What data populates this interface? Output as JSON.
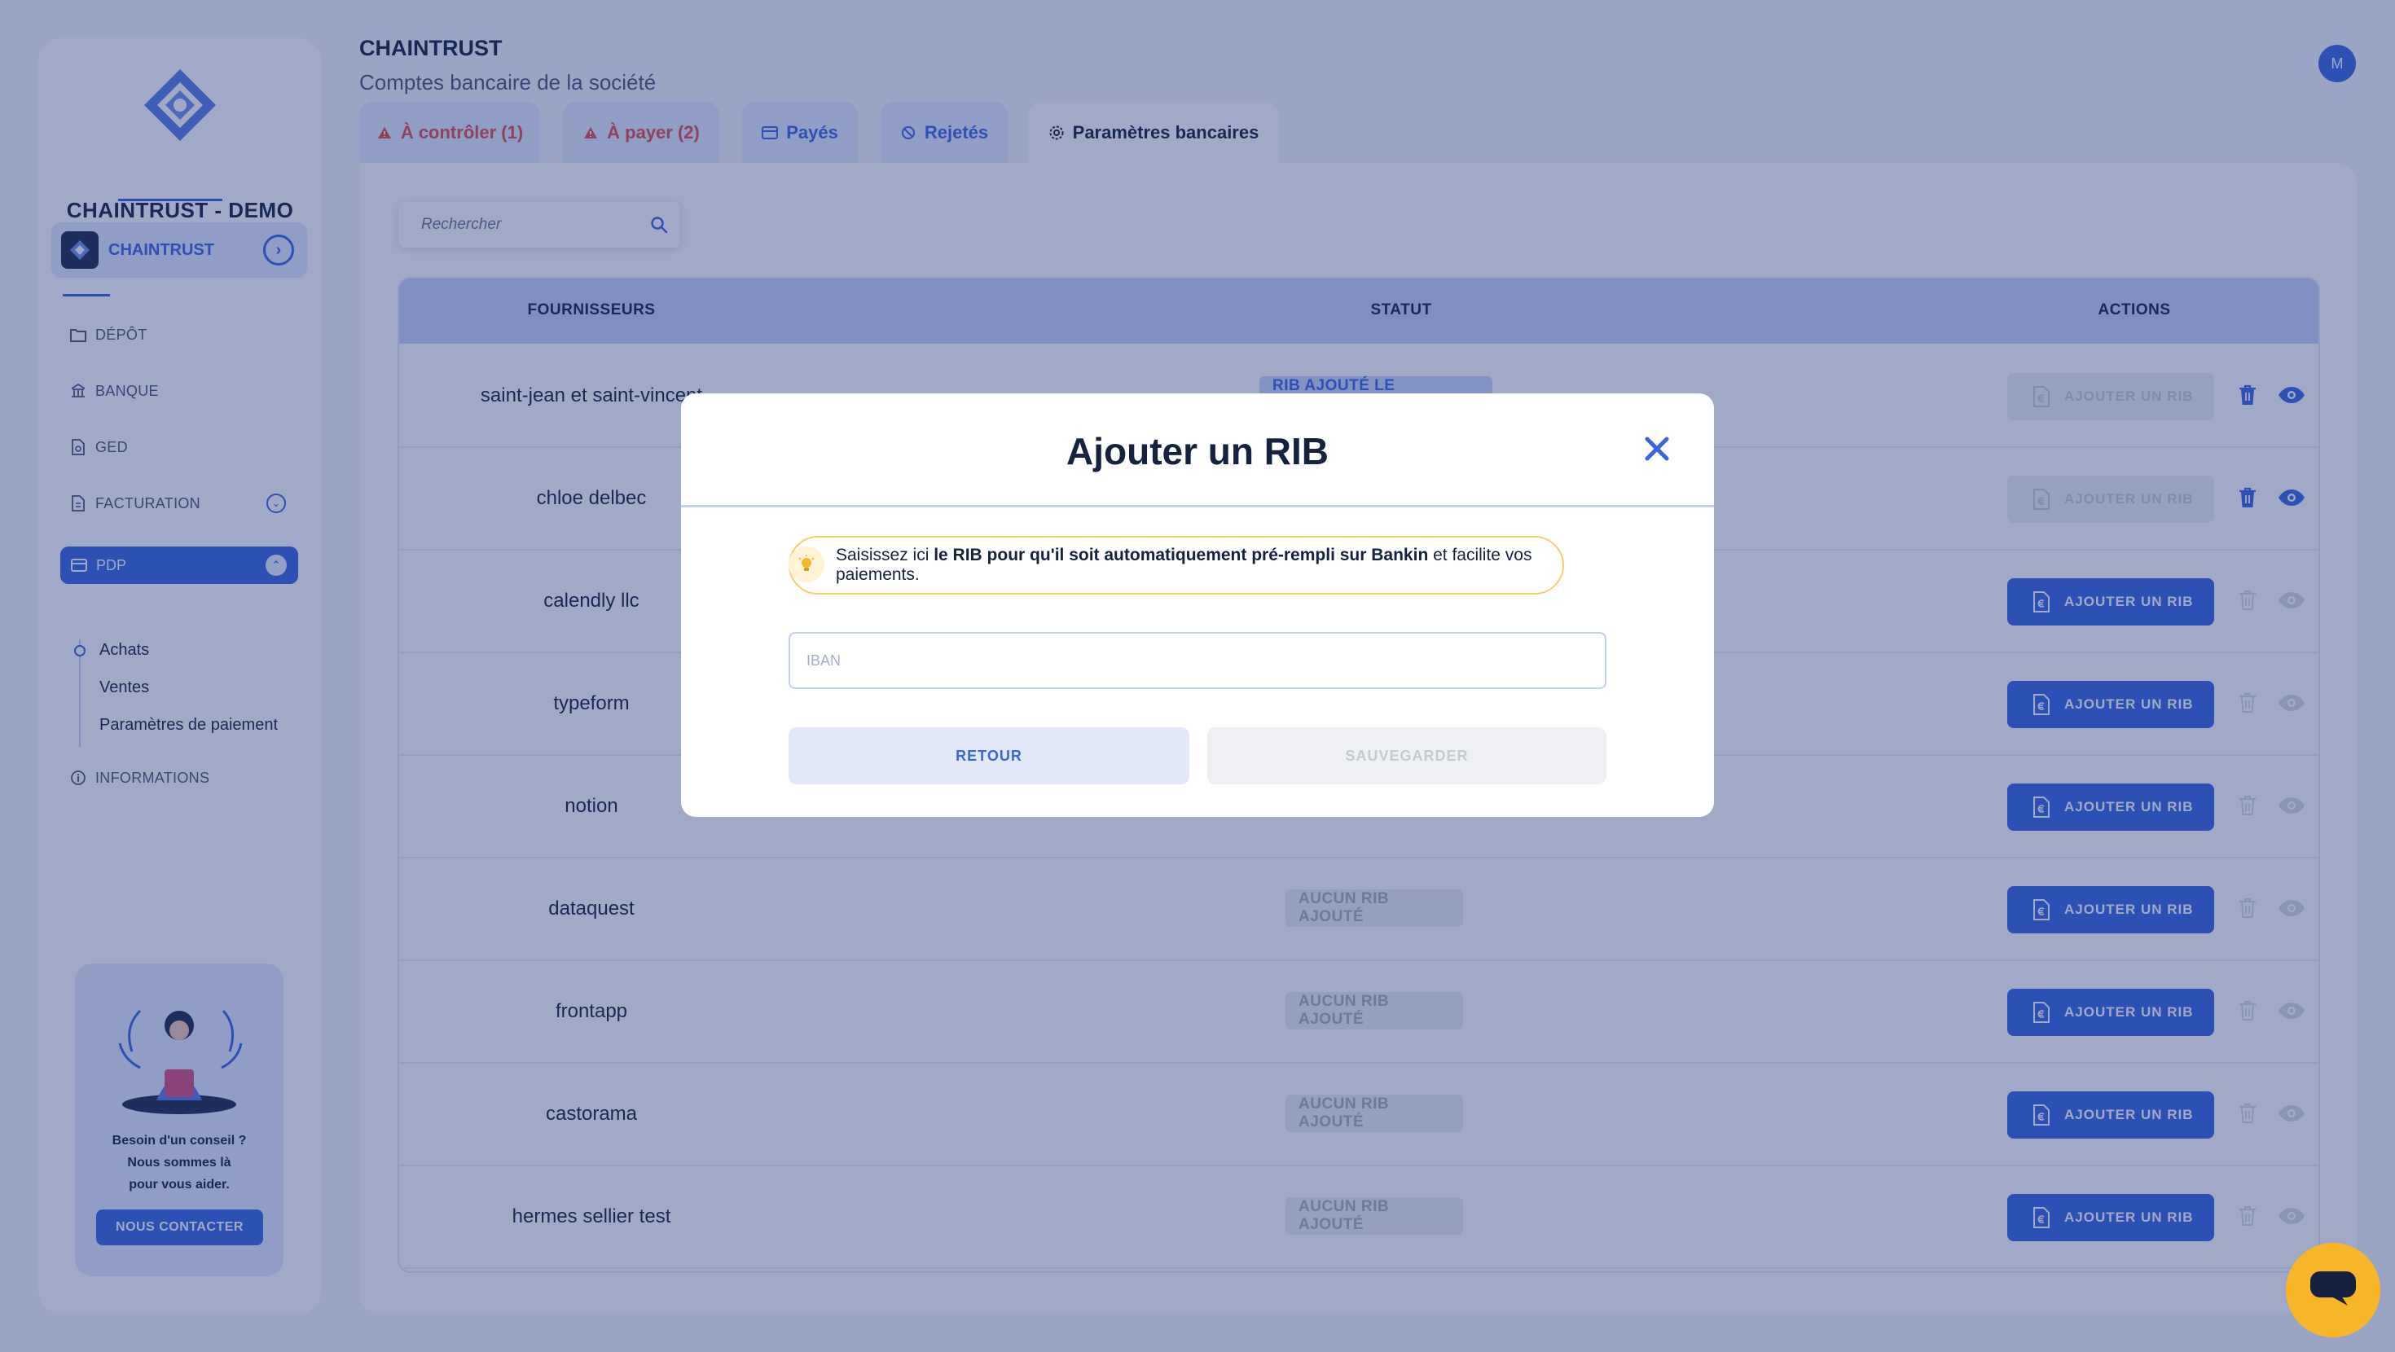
{
  "sidebar": {
    "company_name": "CHAINTRUST - DEMO",
    "account": {
      "name": "CHAINTRUST"
    },
    "nav": [
      {
        "label": "DÉPÔT",
        "icon": "folder-upload-icon"
      },
      {
        "label": "BANQUE",
        "icon": "bank-icon"
      },
      {
        "label": "GED",
        "icon": "document-search-icon"
      },
      {
        "label": "FACTURATION",
        "icon": "invoice-icon"
      },
      {
        "label": "PDP",
        "icon": "card-icon",
        "active": true
      },
      {
        "label": "INFORMATIONS",
        "icon": "info-icon"
      }
    ],
    "pdp_subitems": [
      "Achats",
      "Ventes",
      "Paramètres de paiement"
    ],
    "help": {
      "line1": "Besoin d'un conseil ?",
      "line2": "Nous sommes là",
      "line3": "pour vous aider.",
      "button": "NOUS CONTACTER"
    }
  },
  "header": {
    "title": "CHAINTRUST",
    "subtitle": "Comptes bancaire de la société",
    "user_initial": "M"
  },
  "tabs": [
    {
      "label": "À contrôler (1)",
      "icon": "warning-icon",
      "tone": "red"
    },
    {
      "label": "À payer (2)",
      "icon": "warning-icon",
      "tone": "red"
    },
    {
      "label": "Payés",
      "icon": "card-icon",
      "tone": "blue"
    },
    {
      "label": "Rejetés",
      "icon": "ban-icon",
      "tone": "blue"
    },
    {
      "label": "Paramètres bancaires",
      "icon": "gear-icon",
      "tone": "active"
    }
  ],
  "search": {
    "placeholder": "Rechercher"
  },
  "table": {
    "headers": {
      "supplier": "FOURNISSEURS",
      "status": "STATUT",
      "actions": "ACTIONS"
    },
    "add_label": "AJOUTER UN RIB",
    "rows": [
      {
        "supplier": "saint-jean et saint-vincent",
        "status": "RIB AJOUTÉ LE 18/02/2025",
        "status_kind": "added",
        "add_enabled": false,
        "actions_active": true
      },
      {
        "supplier": "chloe delbec",
        "status": "",
        "status_kind": "hidden",
        "add_enabled": false,
        "actions_active": true
      },
      {
        "supplier": "calendly llc",
        "status": "",
        "status_kind": "hidden",
        "add_enabled": true,
        "actions_active": false
      },
      {
        "supplier": "typeform",
        "status": "",
        "status_kind": "hidden",
        "add_enabled": true,
        "actions_active": false
      },
      {
        "supplier": "notion",
        "status": "",
        "status_kind": "hidden",
        "add_enabled": true,
        "actions_active": false
      },
      {
        "supplier": "dataquest",
        "status": "AUCUN RIB AJOUTÉ",
        "status_kind": "none",
        "add_enabled": true,
        "actions_active": false
      },
      {
        "supplier": "frontapp",
        "status": "AUCUN RIB AJOUTÉ",
        "status_kind": "none",
        "add_enabled": true,
        "actions_active": false
      },
      {
        "supplier": "castorama",
        "status": "AUCUN RIB AJOUTÉ",
        "status_kind": "none",
        "add_enabled": true,
        "actions_active": false
      },
      {
        "supplier": "hermes sellier test",
        "status": "AUCUN RIB AJOUTÉ",
        "status_kind": "none",
        "add_enabled": true,
        "actions_active": false
      }
    ]
  },
  "modal": {
    "title": "Ajouter un RIB",
    "hint_prefix": "Saisissez ici ",
    "hint_bold": "le RIB pour qu'il soit automatiquement pré-rempli sur Bankin",
    "hint_suffix": " et facilite vos paiements.",
    "iban_placeholder": "IBAN",
    "iban_value": "",
    "back_label": "RETOUR",
    "save_label": "SAUVEGARDER"
  },
  "colors": {
    "brand": "#3a64e0",
    "danger": "#e24a4a",
    "chat": "#f7b52a",
    "hint_border": "#f7cf6b"
  }
}
